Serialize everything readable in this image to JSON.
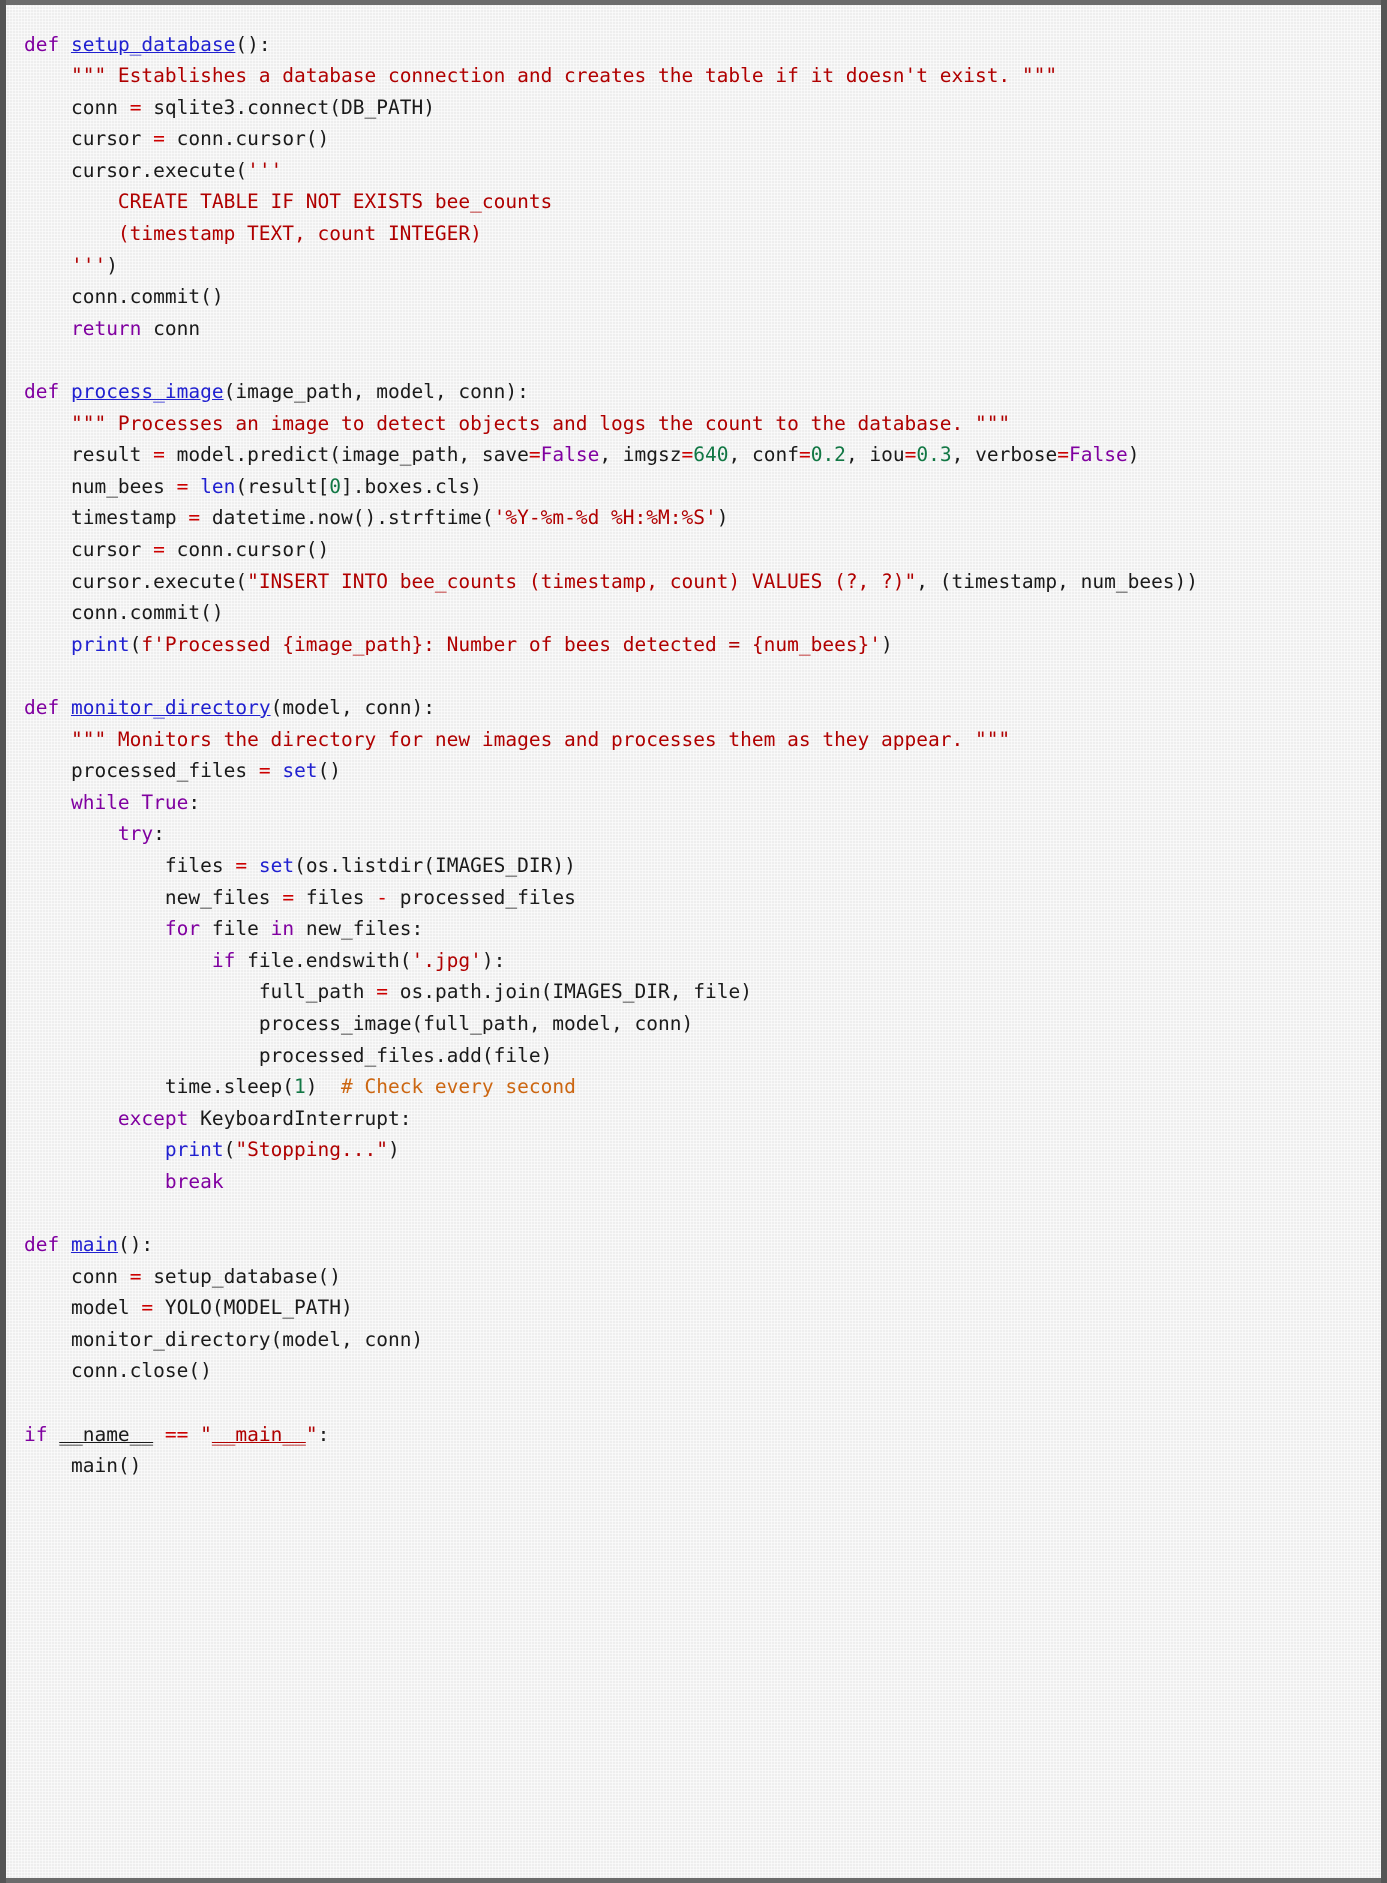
{
  "document": {
    "kind": "python-source-listing",
    "language": "Python",
    "background_color": "#eeeeee",
    "border_color": "#6b6b6b"
  },
  "palette": {
    "keyword": "#8000a0",
    "function_name": "#2020d0",
    "builtin": "#2020d0",
    "string": "#b00000",
    "number": "#117744",
    "operator": "#cc0000",
    "comment": "#cc6611",
    "plain": "#1a1a1a"
  },
  "code": {
    "lines": [
      "def setup_database():",
      "    \"\"\" Establishes a database connection and creates the table if it doesn't exist. \"\"\"",
      "    conn = sqlite3.connect(DB_PATH)",
      "    cursor = conn.cursor()",
      "    cursor.execute('''",
      "        CREATE TABLE IF NOT EXISTS bee_counts",
      "        (timestamp TEXT, count INTEGER)",
      "    ''')",
      "    conn.commit()",
      "    return conn",
      "",
      "def process_image(image_path, model, conn):",
      "    \"\"\" Processes an image to detect objects and logs the count to the database. \"\"\"",
      "    result = model.predict(image_path, save=False, imgsz=640, conf=0.2, iou=0.3, verbose=False)",
      "    num_bees = len(result[0].boxes.cls)",
      "    timestamp = datetime.now().strftime('%Y-%m-%d %H:%M:%S')",
      "    cursor = conn.cursor()",
      "    cursor.execute(\"INSERT INTO bee_counts (timestamp, count) VALUES (?, ?)\", (timestamp, num_bees))",
      "    conn.commit()",
      "    print(f'Processed {image_path}: Number of bees detected = {num_bees}')",
      "",
      "def monitor_directory(model, conn):",
      "    \"\"\" Monitors the directory for new images and processes them as they appear. \"\"\"",
      "    processed_files = set()",
      "    while True:",
      "        try:",
      "            files = set(os.listdir(IMAGES_DIR))",
      "            new_files = files - processed_files",
      "            for file in new_files:",
      "                if file.endswith('.jpg'):",
      "                    full_path = os.path.join(IMAGES_DIR, file)",
      "                    process_image(full_path, model, conn)",
      "                    processed_files.add(file)",
      "            time.sleep(1)  # Check every second",
      "        except KeyboardInterrupt:",
      "            print(\"Stopping...\")",
      "            break",
      "",
      "def main():",
      "    conn = setup_database()",
      "    model = YOLO(MODEL_PATH)",
      "    monitor_directory(model, conn)",
      "    conn.close()",
      "",
      "if __name__ == \"__main__\":",
      "    main()"
    ],
    "identifiers": {
      "functions_defined": [
        "setup_database",
        "process_image",
        "monitor_directory",
        "main"
      ],
      "builtins_used": [
        "len",
        "set",
        "print"
      ],
      "constants": [
        "DB_PATH",
        "IMAGES_DIR",
        "MODEL_PATH"
      ],
      "table_name": "bee_counts"
    },
    "literals": {
      "imgsz": "640",
      "conf": "0.2",
      "iou": "0.3",
      "index": "0",
      "sleep_seconds": "1",
      "time_format": "'%Y-%m-%d %H:%M:%S'",
      "file_extension": "'.jpg'",
      "stopping_message": "\"Stopping...\"",
      "main_guard": "\"__main__\""
    },
    "comments": [
      "# Check every second"
    ],
    "docstrings": [
      "\"\"\" Establishes a database connection and creates the table if it doesn't exist. \"\"\"",
      "\"\"\" Processes an image to detect objects and logs the count to the database. \"\"\"",
      "\"\"\" Monitors the directory for new images and processes them as they appear. \"\"\""
    ]
  }
}
